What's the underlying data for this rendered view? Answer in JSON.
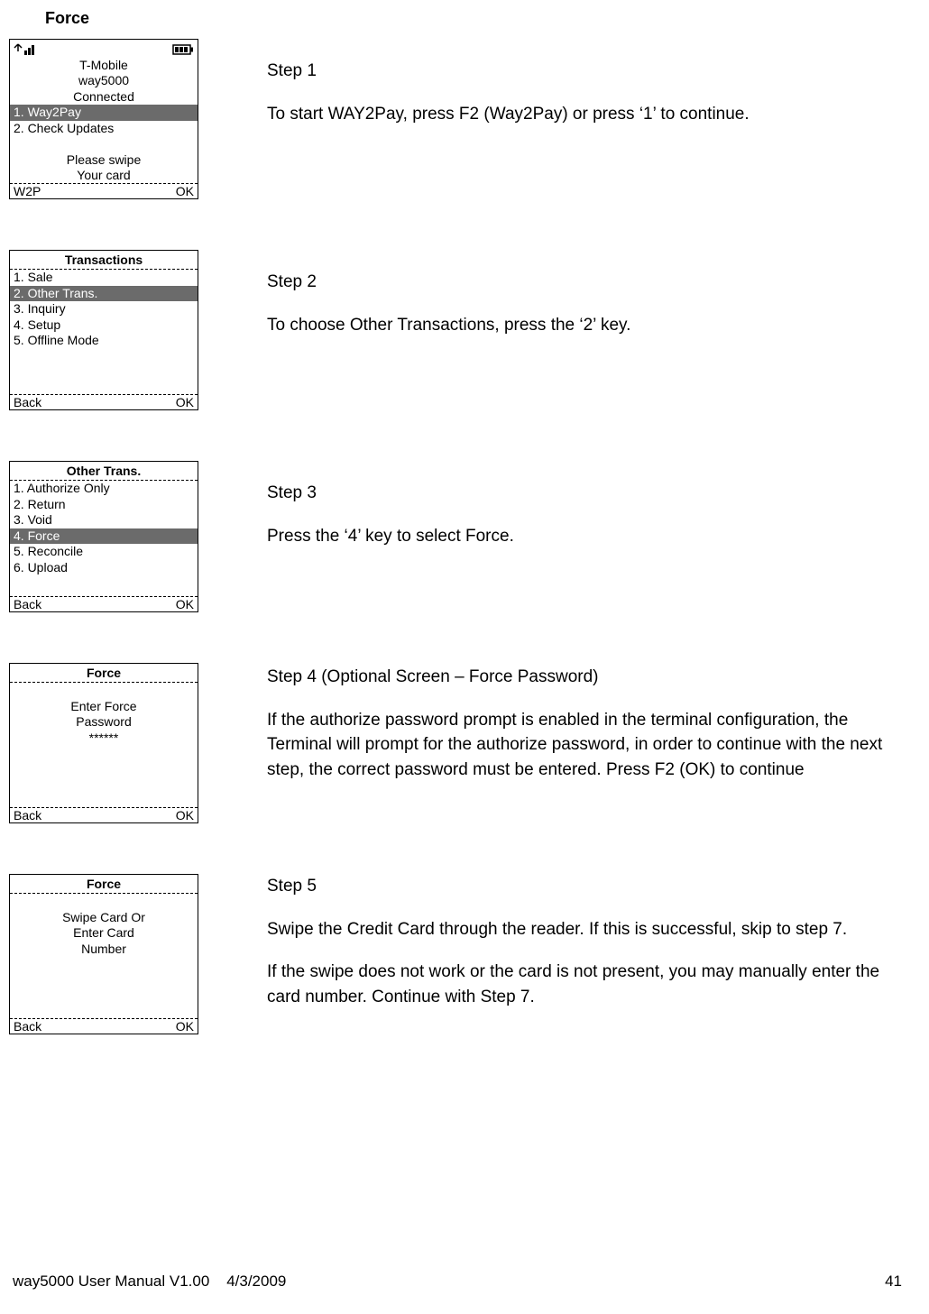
{
  "page_title": "Force",
  "footer": {
    "left": "way5000 User Manual V1.00",
    "date": "4/3/2009",
    "page": "41"
  },
  "steps": [
    {
      "title": "Step 1",
      "paragraphs": [
        "To start WAY2Pay, press F2 (Way2Pay) or press ‘1’ to continue."
      ],
      "terminal": {
        "status_icons": true,
        "top_lines": [
          "T-Mobile",
          "way5000",
          "Connected"
        ],
        "items": [
          {
            "label": "1. Way2Pay",
            "selected": true
          },
          {
            "label": "2. Check Updates",
            "selected": false
          }
        ],
        "bottom_lines": [
          "Please swipe",
          "Your card"
        ],
        "footer_left": "W2P",
        "footer_right": "OK"
      }
    },
    {
      "title": "Step 2",
      "paragraphs": [
        "To choose Other Transactions, press the ‘2’ key."
      ],
      "terminal": {
        "header": "Transactions",
        "items": [
          {
            "label": "1. Sale",
            "selected": false
          },
          {
            "label": "2. Other Trans.",
            "selected": true
          },
          {
            "label": "3. Inquiry",
            "selected": false
          },
          {
            "label": "4. Setup",
            "selected": false
          },
          {
            "label": "5. Offline Mode",
            "selected": false
          }
        ],
        "footer_left": "Back",
        "footer_right": "OK",
        "min_body_lines": 9
      }
    },
    {
      "title": "Step 3",
      "paragraphs": [
        "Press the ‘4’ key to select Force."
      ],
      "terminal": {
        "header": "Other Trans.",
        "items": [
          {
            "label": "1. Authorize Only",
            "selected": false
          },
          {
            "label": "2. Return",
            "selected": false
          },
          {
            "label": "3. Void",
            "selected": false
          },
          {
            "label": "4. Force",
            "selected": true
          },
          {
            "label": "5. Reconcile",
            "selected": false
          },
          {
            "label": "6. Upload",
            "selected": false
          }
        ],
        "footer_left": "Back",
        "footer_right": "OK",
        "min_body_lines": 8
      }
    },
    {
      "title": "Step 4 (Optional Screen – Force Password)",
      "paragraphs": [
        "If the authorize password prompt is enabled in the terminal configuration, the Terminal will prompt for the authorize password, in order to continue with the next step, the correct password must be entered. Press F2 (OK) to continue"
      ],
      "terminal": {
        "header": "Force",
        "body_center": [
          "",
          "Enter Force",
          "Password",
          "******"
        ],
        "footer_left": "Back",
        "footer_right": "OK",
        "min_body_lines": 8
      }
    },
    {
      "title": "Step 5",
      "paragraphs": [
        "Swipe the Credit Card through the reader.  If this is successful, skip to step 7.",
        "If the swipe does not work or the card is not present, you may manually enter the card number. Continue with Step 7."
      ],
      "terminal": {
        "header": "Force",
        "body_center": [
          "",
          "Swipe Card Or",
          "Enter Card",
          "Number"
        ],
        "footer_left": "Back",
        "footer_right": "OK",
        "min_body_lines": 8
      }
    }
  ]
}
